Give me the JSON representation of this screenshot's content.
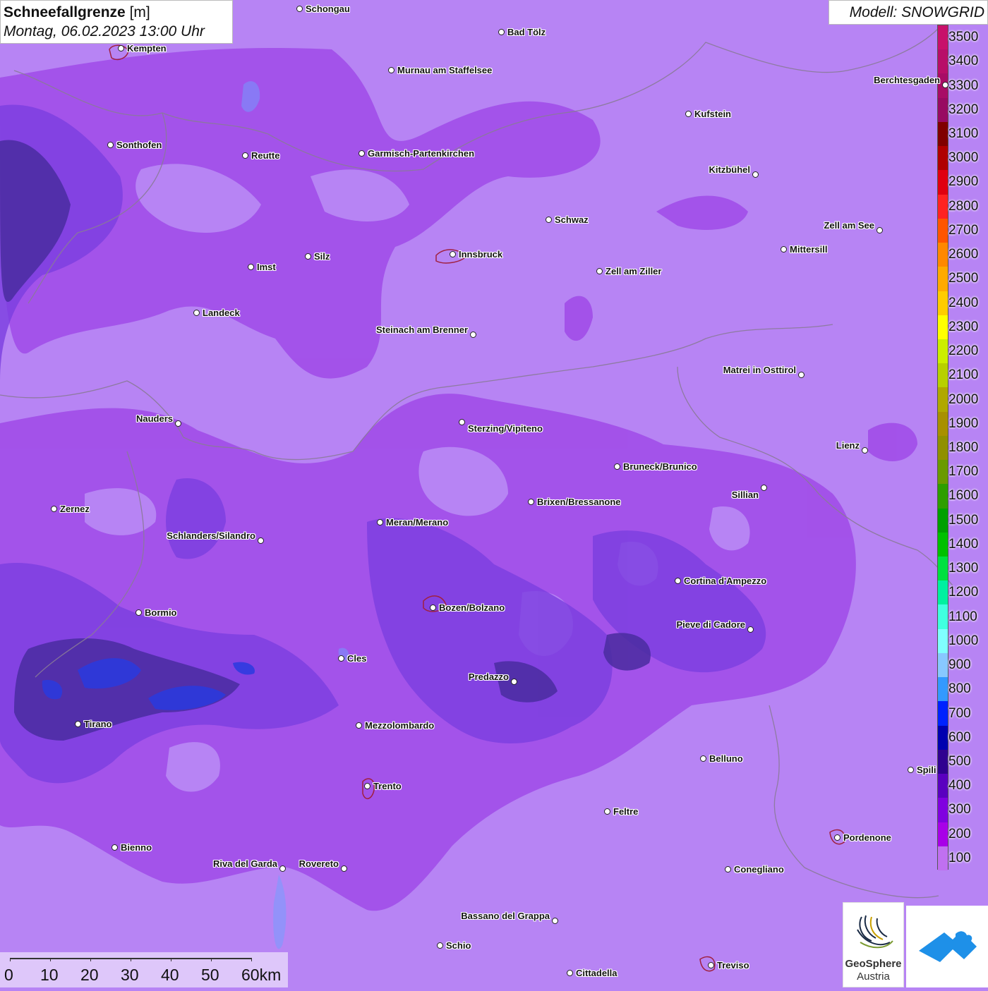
{
  "title": {
    "main": "Schneefallgrenze",
    "unit": "[m]",
    "datetime": "Montag, 06.02.2023 13:00 Uhr"
  },
  "model_label": "Modell: SNOWGRID",
  "legend": {
    "values": [
      3500,
      3400,
      3300,
      3200,
      3100,
      3000,
      2900,
      2800,
      2700,
      2600,
      2500,
      2400,
      2300,
      2200,
      2100,
      2000,
      1900,
      1800,
      1700,
      1600,
      1500,
      1400,
      1300,
      1200,
      1100,
      1000,
      900,
      800,
      700,
      600,
      500,
      400,
      300,
      200,
      100
    ],
    "colors": [
      "#c8106a",
      "#b80e68",
      "#a80c66",
      "#980a62",
      "#800000",
      "#b00000",
      "#e00010",
      "#ff2222",
      "#ff5500",
      "#ff8800",
      "#ffaa00",
      "#ffcc00",
      "#ffff00",
      "#ccee00",
      "#b8d000",
      "#b0a800",
      "#a89000",
      "#909000",
      "#6a9a00",
      "#2e9e00",
      "#00a000",
      "#00c000",
      "#00e040",
      "#00f0a0",
      "#40ffe0",
      "#80ffff",
      "#88c8ff",
      "#3399ff",
      "#0022ff",
      "#0000b0",
      "#300090",
      "#5a00c0",
      "#8000e0",
      "#a800e8",
      "#c070f0"
    ]
  },
  "cities": [
    {
      "name": "Schongau"
    },
    {
      "name": "Bad Tölz"
    },
    {
      "name": "Kempten"
    },
    {
      "name": "Murnau am Staffelsee"
    },
    {
      "name": "Kufstein"
    },
    {
      "name": "Berchtesgaden"
    },
    {
      "name": "Sonthofen"
    },
    {
      "name": "Reutte"
    },
    {
      "name": "Garmisch-Partenkirchen"
    },
    {
      "name": "Kitzbühel"
    },
    {
      "name": "Schwaz"
    },
    {
      "name": "Zell am See"
    },
    {
      "name": "Innsbruck"
    },
    {
      "name": "Mittersill"
    },
    {
      "name": "Imst"
    },
    {
      "name": "Silz"
    },
    {
      "name": "Zell am Ziller"
    },
    {
      "name": "Landeck"
    },
    {
      "name": "Steinach am Brenner"
    },
    {
      "name": "Matrei in Osttirol"
    },
    {
      "name": "Nauders"
    },
    {
      "name": "Sterzing/Vipiteno"
    },
    {
      "name": "Lienz"
    },
    {
      "name": "Bruneck/Brunico"
    },
    {
      "name": "Sillian"
    },
    {
      "name": "Zernez"
    },
    {
      "name": "Brixen/Bressanone"
    },
    {
      "name": "Meran/Merano"
    },
    {
      "name": "Schlanders/Silandro"
    },
    {
      "name": "Cortina d'Ampezzo"
    },
    {
      "name": "Bozen/Bolzano"
    },
    {
      "name": "Bormio"
    },
    {
      "name": "Pieve di Cadore"
    },
    {
      "name": "Cles"
    },
    {
      "name": "Predazzo"
    },
    {
      "name": "Tirano"
    },
    {
      "name": "Mezzolombardo"
    },
    {
      "name": "Belluno"
    },
    {
      "name": "Trento"
    },
    {
      "name": "Feltre"
    },
    {
      "name": "Pordenone"
    },
    {
      "name": "Bienno"
    },
    {
      "name": "Riva del Garda"
    },
    {
      "name": "Rovereto"
    },
    {
      "name": "Conegliano"
    },
    {
      "name": "Bassano del Grappa"
    },
    {
      "name": "Schio"
    },
    {
      "name": "Treviso"
    },
    {
      "name": "Cittadella"
    },
    {
      "name": "Spili"
    }
  ],
  "scalebar": {
    "labels": [
      "0",
      "10",
      "20",
      "30",
      "40",
      "50",
      "60km"
    ]
  },
  "logos": {
    "geosphere_line1": "GeoSphere",
    "geosphere_line2": "Austria"
  },
  "colors": {
    "background": "#b784f4",
    "mid_snowline": "#a04ae8",
    "low_snowline": "#7a3ee0",
    "lowest_snowline": "#4a2ca0",
    "deep_blue": "#2a3ae0",
    "border_line": "#8a7a98"
  }
}
